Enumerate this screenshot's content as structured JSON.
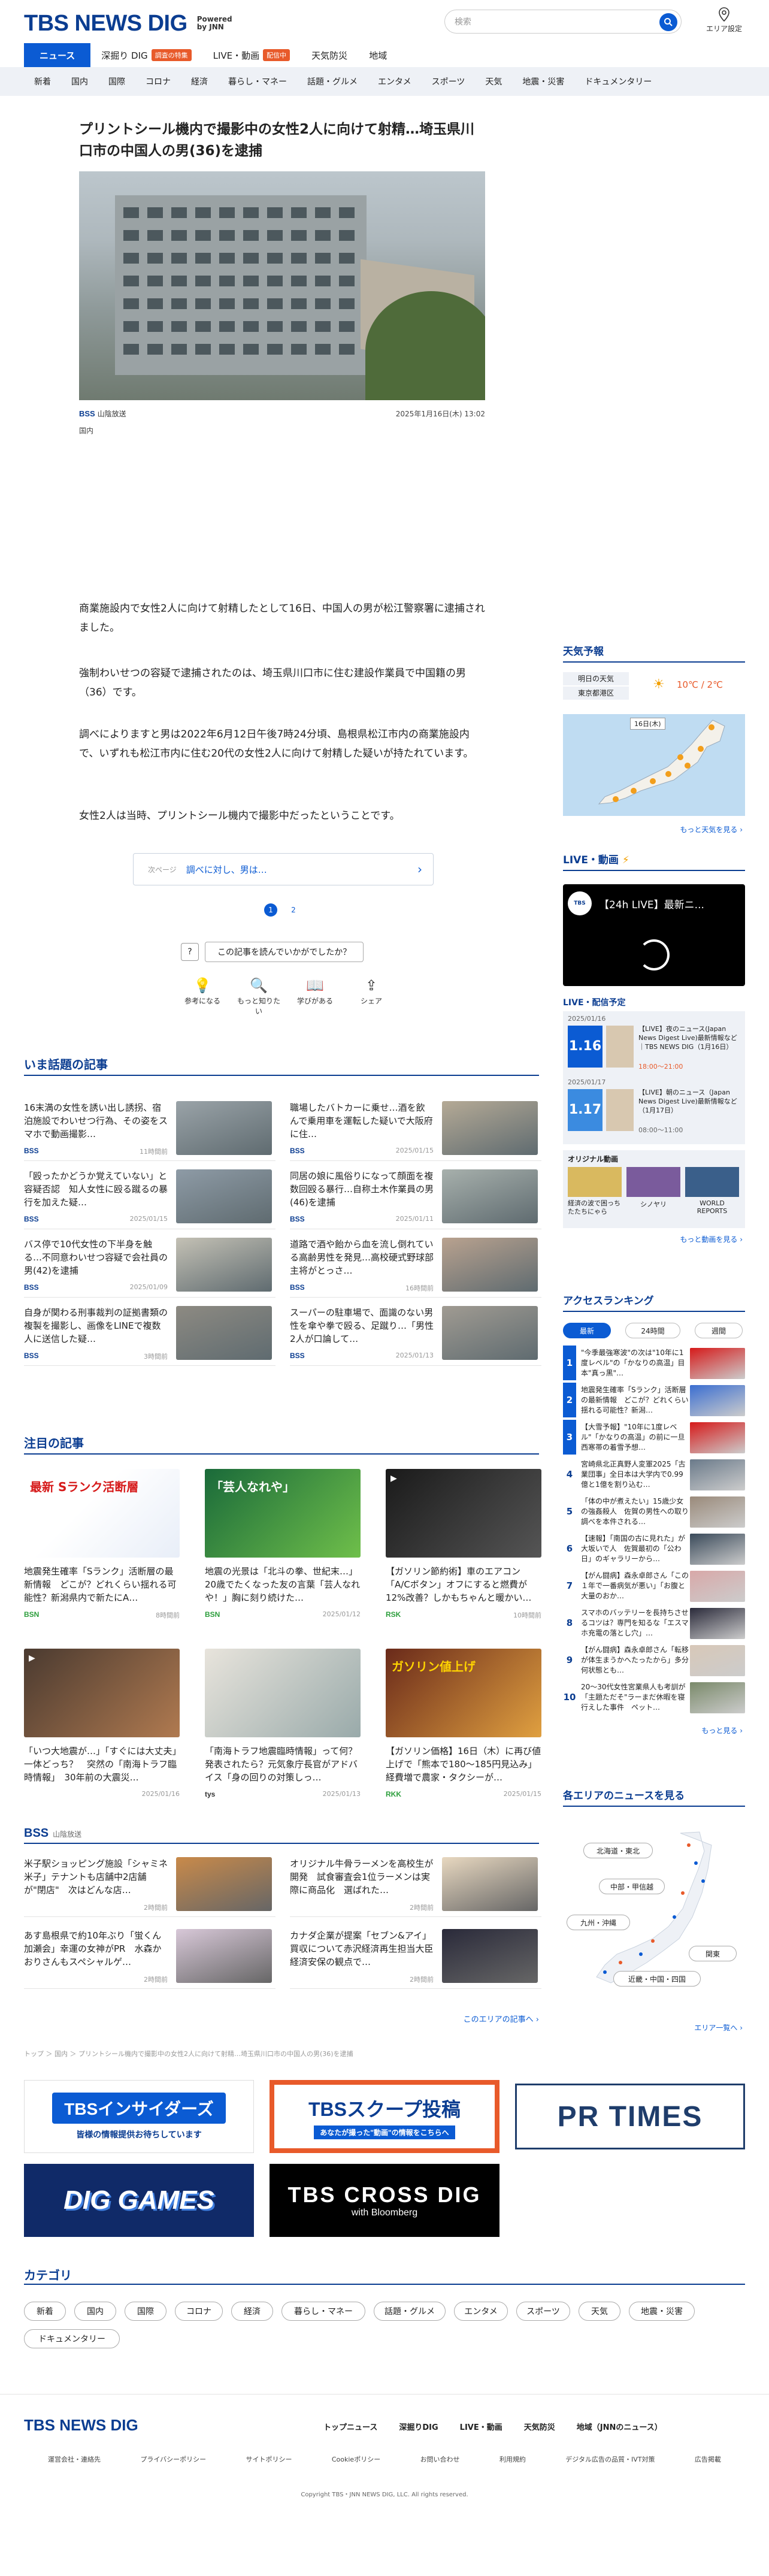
{
  "header": {
    "logo": "TBS NEWS DIG",
    "powered": "Powered by JNN",
    "search_placeholder": "検索",
    "area_label": "エリア設定",
    "nav": [
      {
        "label": "ニュース",
        "badge": ""
      },
      {
        "label": "深掘り DIG",
        "badge": "調査の特集"
      },
      {
        "label": "LIVE・動画",
        "badge": "配信中"
      },
      {
        "label": "天気防災",
        "badge": ""
      },
      {
        "label": "地域",
        "badge": ""
      }
    ],
    "subnav": [
      "新着",
      "国内",
      "国際",
      "コロナ",
      "経済",
      "暮らし・マネー",
      "話題・グルメ",
      "エンタメ",
      "スポーツ",
      "天気",
      "地震・災害",
      "ドキュメンタリー"
    ]
  },
  "article": {
    "title": "プリントシール機内で撮影中の女性2人に向けて射精…埼玉県川口市の中国人の男(36)を逮捕",
    "source_logo": "BSS",
    "source": "山陰放送",
    "date": "2025年1月16日(木) 13:02",
    "category": "国内",
    "paragraphs": [
      "商業施設内で女性2人に向けて射精したとして16日、中国人の男が松江警察署に逮捕されました。",
      "強制わいせつの容疑で逮捕されたのは、埼玉県川口市に住む建設作業員で中国籍の男（36）です。",
      "調べによりますと男は2022年6月12日午後7時24分頃、島根県松江市内の商業施設内で、いずれも松江市内に住む20代の女性2人に向けて射精した疑いが持たれています。",
      "女性2人は当時、プリントシール機内で撮影中だったということです。"
    ],
    "next_label": "次ページ",
    "next_title": "調べに対し、男は…",
    "pages": [
      "1",
      "2"
    ],
    "survey": "この記事を読んでいかがでしたか？",
    "reactions": [
      {
        "icon": "bulb-icon",
        "label": "参考になる"
      },
      {
        "icon": "search-icon",
        "label": "もっと知りたい"
      },
      {
        "icon": "book-icon",
        "label": "学びがある"
      },
      {
        "icon": "share-icon",
        "label": "シェア"
      }
    ]
  },
  "topics": {
    "title": "いま話題の記事",
    "items": [
      {
        "title": "16末満の女性を誘い出し誘拐、宿泊施設でわいせつ行為、その姿をスマホで動画撮影…",
        "src": "BSS",
        "time": "11時間前"
      },
      {
        "title": "職場したバトカーに乗せ…酒を飲んで乗用車を運転した疑いで大阪府に住…",
        "src": "BSS",
        "time": "2025/01/15"
      },
      {
        "title": "「殴ったかどうか覚えていない」と容疑否認　知人女性に殴る蹴るの暴行を加えた疑…",
        "src": "BSS",
        "time": "2025/01/15"
      },
      {
        "title": "同居の娘に風俗りになって顔面を複数回殴る暴行…自称土木作業員の男(46)を逮捕",
        "src": "BSS",
        "time": "2025/01/11"
      },
      {
        "title": "バス停で10代女性の下半身を触る…不同意わいせつ容疑で会社員の男(42)を逮捕",
        "src": "BSS",
        "time": "2025/01/09"
      },
      {
        "title": "道路で酒や飴から血を流し倒れている高齢男性を発見…高校硬式野球部主将がとっさ…",
        "src": "BSS",
        "time": "16時間前"
      },
      {
        "title": "自身が関わる刑事裁判の証拠書類の複製を撮影し、画像をLINEで複数人に送信した疑…",
        "src": "BSS",
        "time": "3時間前"
      },
      {
        "title": "スーパーの駐車場で、面識のない男性を傘や拳で殴る、足蹴り…「男性2人が口論して…",
        "src": "BSS",
        "time": "2025/01/13"
      }
    ]
  },
  "featured": {
    "title": "注目の記事",
    "items": [
      {
        "title": "地震発生確率「Sランク」活断層の最新情報　どこが？どれくらい揺れる可能性？新潟県内で新たにA…",
        "src": "BSN",
        "time": "8時間前",
        "img": "最新 Sランク活断層"
      },
      {
        "title": "地震の光景は「北斗の拳、世紀末…」20歳でたくなった友の言葉「芸人なれや！」胸に刻り続けた…",
        "src": "BSN",
        "time": "2025/01/12",
        "img": "「芸人なれや」"
      },
      {
        "title": "【ガソリン節約術】車のエアコン「A/Cボタン」オフにすると燃費が12%改善？しかもちゃんと暖かい…",
        "src": "RSK",
        "time": "10時間前",
        "img": ""
      },
      {
        "title": "「いつ大地震が…」「すぐには大丈夫」一体どっち？　突然の「南海トラフ臨時情報」　30年前の大震災…",
        "src": "",
        "time": "2025/01/16",
        "img": ""
      },
      {
        "title": "「南海トラフ地震臨時情報」って何？発表されたら？元気象庁長官がアドバイス「身の回りの対策しっ…",
        "src": "tys",
        "time": "2025/01/13",
        "img": ""
      },
      {
        "title": "【ガソリン価格】16日（木）に再び値上げで「熊本で180〜185円見込み」経費増で農家・タクシーが…",
        "src": "RKK",
        "time": "2025/01/15",
        "img": "ガソリン値上げ"
      }
    ]
  },
  "local": {
    "logo": "BSS",
    "name": "山陰放送",
    "more": "このエリアの記事へ",
    "items": [
      {
        "title": "米子駅ショッピング施設「シャミネ米子」テナントも店舗中2店舗が\"閉店\"　次はどんな店…",
        "time": "2時間前"
      },
      {
        "title": "オリジナル牛骨ラーメンを高校生が開発　試食審査会1位ラーメンは実際に商品化　選ばれた…",
        "time": "2時間前"
      },
      {
        "title": "あす島根県で約10年ぶり「蛍くん加瀬会」幸運の女神がPR　水森かおりさんもスペシャルゲ…",
        "time": "2時間前"
      },
      {
        "title": "カナダ企業が提案「セブン&アイ」買収について赤沢経済再生担当大臣　経済安保の観点で…",
        "time": "2時間前"
      }
    ]
  },
  "breadcrumb": "トップ ＞ 国内 ＞ プリントシール機内で撮影中の女性2人に向けて射精…埼玉県川口市の中国人の男(36)を逮捕",
  "banners": [
    {
      "name": "TBSインサイダーズ",
      "sub": "皆様の情報提供お待ちしています"
    },
    {
      "name": "TBSスクープ投稿",
      "sub": "あなたが撮った\"動画\"の情報をこちらへ"
    },
    {
      "name": "PR TIMES",
      "sub": ""
    },
    {
      "name": "DIG GAMES",
      "sub": ""
    },
    {
      "name": "TBS CROSS DIG",
      "sub": "with Bloomberg"
    }
  ],
  "category": {
    "title": "カテゴリ",
    "chips": [
      "新着",
      "国内",
      "国際",
      "コロナ",
      "経済",
      "暮らし・マネー",
      "話題・グルメ",
      "エンタメ",
      "スポーツ",
      "天気",
      "地震・災害",
      "ドキュメンタリー"
    ]
  },
  "sidebar": {
    "weather_title": "天気予報",
    "weather_day": "明日の天気",
    "weather_area": "東京都港区",
    "weather_temp": "10℃ / 2℃",
    "map_label": "16日(木)",
    "weather_more": "もっと天気を見る",
    "live_title": "LIVE・動画",
    "live_video": "【24h LIVE】最新ニ...",
    "schedule_title": "LIVE・配信予定",
    "schedule": [
      {
        "date": "2025/01/16",
        "day": "1.16",
        "title": "【LIVE】夜のニュース(Japan News Digest Live)最新情報など｜TBS NEWS DIG（1月16日）",
        "time": "18:00〜21:00"
      },
      {
        "date": "2025/01/17",
        "day": "1.17",
        "title": "【LIVE】朝のニュース（Japan News Digest Live)最新情報など（1月17日）",
        "time": "08:00〜11:00"
      }
    ],
    "original_title": "オリジナル動画",
    "originals": [
      "経済の波で困っちたたちにゃら",
      "シノヤリ",
      "WORLD REPORTS"
    ],
    "video_more": "もっと動画を見る",
    "ranking_title": "アクセスランキング",
    "ranking_tabs": [
      "最新",
      "24時間",
      "週間"
    ],
    "ranking": [
      {
        "n": "1",
        "t": "\"今季最強寒波\"の次は\"10年に1度レベル\"の「かなりの高温」目本\"真っ黒\"…"
      },
      {
        "n": "2",
        "t": "地震発生確率「Sランク」活断層の最新情報　どこが？どれくらい揺れる可能性？新潟…"
      },
      {
        "n": "3",
        "t": "【大雪予報】\"10年に1度レベル\"「かなりの高温」の前に一旦西寒帯の着雪予想…"
      },
      {
        "n": "4",
        "t": "宮崎県北正真野人変軍2025「古業団事」全日本は大学内で0.99億と1億を割り込む…"
      },
      {
        "n": "5",
        "t": "「体の中が煮えたい」15歳少女の強姦殺人　佐賀の男性への取り調べを本件される…"
      },
      {
        "n": "6",
        "t": "【速報】「南国の古に見れた」が大坂いで人　佐賀最初の「公わ日」のギャラリーから…"
      },
      {
        "n": "7",
        "t": "【がん闘病】森永卓郎さん「この１年で一番病気が悪い」「お腹と大量のおか…"
      },
      {
        "n": "8",
        "t": "スマホのバッテリーを長持ちさせるコツは？専門を知るな「エスマホ充電の落とし穴」…"
      },
      {
        "n": "9",
        "t": "【がん闘病】森永卓郎さん「転移が体生まうかへたったから」多分何状態とも…"
      },
      {
        "n": "10",
        "t": "20〜30代女性宮業県人も考訓が「主題ただそ\"ラーまだ休暇を寝行えした事件　ペット…"
      }
    ],
    "ranking_more": "もっと見る",
    "area_title": "各エリアのニュースを見る",
    "areas": [
      "北海道・東北",
      "中部・甲信越",
      "九州・沖縄",
      "関東",
      "近畿・中国・四国"
    ],
    "area_more": "エリア一覧へ"
  },
  "footer": {
    "logo": "TBS NEWS DIG",
    "links": [
      "トップニュース",
      "深掘りDIG",
      "LIVE・動画",
      "天気防災",
      "地域（JNNのニュース）"
    ],
    "sublinks": [
      "運営会社・連絡先",
      "プライバシーポリシー",
      "サイトポリシー",
      "Cookieポリシー",
      "お問い合わせ",
      "利用規約",
      "デジタル広告の品質・IVT対策",
      "広告掲載"
    ],
    "copyright": "Copyright TBS・JNN NEWS DIG, LLC. All rights reserved."
  },
  "colors": {
    "brand": "#0b3d91",
    "accent": "#0b5bd3",
    "badge": "#e85a2a",
    "subnav_bg": "#eef1f6"
  }
}
